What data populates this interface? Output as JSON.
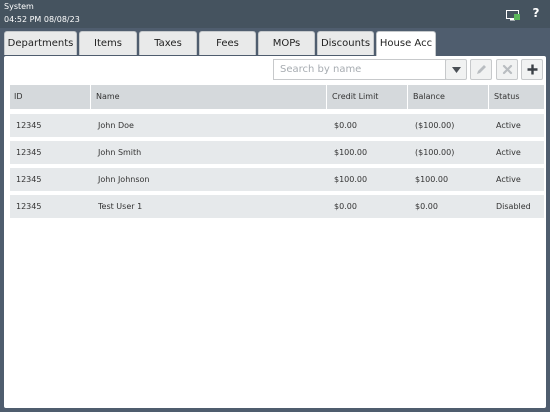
{
  "topbar": {
    "title": "System",
    "datetime": "04:52 PM 08/08/23",
    "help": "?",
    "monitor_icon": "monitor-icon"
  },
  "tabs": [
    {
      "label": "Departments"
    },
    {
      "label": "Items"
    },
    {
      "label": "Taxes"
    },
    {
      "label": "Fees"
    },
    {
      "label": "MOPs"
    },
    {
      "label": "Discounts"
    },
    {
      "label": "House Acc",
      "active": true
    }
  ],
  "toolbar": {
    "search_placeholder": "Search by name",
    "icons": [
      "chevron-down-icon",
      "pencil-icon",
      "close-icon",
      "plus-icon"
    ]
  },
  "table": {
    "columns": [
      "ID",
      "Name",
      "Credit Limit",
      "Balance",
      "Status"
    ],
    "rows": [
      [
        "12345",
        "John Doe",
        "$0.00",
        "($100.00)",
        "Active"
      ],
      [
        "12345",
        "John Smith",
        "$100.00",
        "($100.00)",
        "Active"
      ],
      [
        "12345",
        "John Johnson",
        "$100.00",
        "$100.00",
        "Active"
      ],
      [
        "12345",
        "Test User 1",
        "$0.00",
        "$0.00",
        "Disabled"
      ]
    ]
  },
  "colors": {
    "topbar": "#45535f",
    "background": "#4f5d6e",
    "header": "#d5d9dc",
    "row": "#e6e9eb",
    "accent_green": "#5cb85c"
  }
}
